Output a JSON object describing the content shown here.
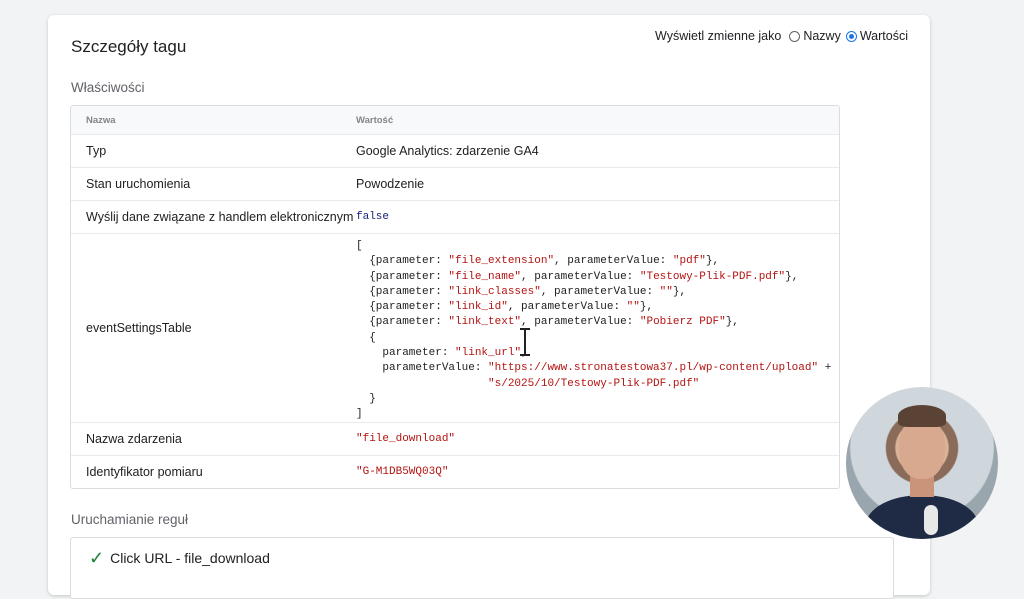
{
  "panel": {
    "title": "Szczegóły tagu",
    "display_toggle": {
      "label": "Wyświetl zmienne jako",
      "options": [
        {
          "label": "Nazwy",
          "selected": false
        },
        {
          "label": "Wartości",
          "selected": true
        }
      ]
    }
  },
  "properties": {
    "section_label": "Właściwości",
    "columns": {
      "name": "Nazwa",
      "value": "Wartość"
    },
    "rows": {
      "type": {
        "name": "Typ",
        "value": "Google Analytics: zdarzenie GA4"
      },
      "status": {
        "name": "Stan uruchomienia",
        "value": "Powodzenie"
      },
      "ecommerce": {
        "name": "Wyślij dane związane z handlem elektronicznym",
        "value": "false"
      },
      "event_settings": {
        "name": "eventSettingsTable",
        "lines": {
          "open": "[",
          "p1_a": "  {parameter: ",
          "p1_b": "\"file_extension\"",
          "p1_c": ", parameterValue: ",
          "p1_d": "\"pdf\"",
          "p1_e": "},",
          "p2_a": "  {parameter: ",
          "p2_b": "\"file_name\"",
          "p2_c": ", parameterValue: ",
          "p2_d": "\"Testowy-Plik-PDF.pdf\"",
          "p2_e": "},",
          "p3_a": "  {parameter: ",
          "p3_b": "\"link_classes\"",
          "p3_c": ", parameterValue: ",
          "p3_d": "\"\"",
          "p3_e": "},",
          "p4_a": "  {parameter: ",
          "p4_b": "\"link_id\"",
          "p4_c": ", parameterValue: ",
          "p4_d": "\"\"",
          "p4_e": "},",
          "p5_a": "  {parameter: ",
          "p5_b": "\"link_text\"",
          "p5_c": ", parameterValue: ",
          "p5_d": "\"Pobierz PDF\"",
          "p5_e": "},",
          "obj_open": "  {",
          "p6_a": "    parameter: ",
          "p6_b": "\"link_url\"",
          "p6_c": ",",
          "p7_a": "    parameterValue: ",
          "p7_b": "\"https://www.stronatestowa37.pl/wp-content/upload\"",
          "p7_c": " +",
          "p8_a": "                    ",
          "p8_b": "\"s/2025/10/Testowy-Plik-PDF.pdf\"",
          "obj_close": "  }",
          "close": "]"
        }
      },
      "event_name": {
        "name": "Nazwa zdarzenia",
        "value": "\"file_download\""
      },
      "measurement_id": {
        "name": "Identyfikator pomiaru",
        "value": "\"G-M1DB5WQ03Q\""
      }
    }
  },
  "firing_rules": {
    "section_label": "Uruchamianie reguł",
    "items": [
      {
        "label": "Click URL - file_download",
        "status": "check-icon"
      }
    ]
  },
  "colors": {
    "accent": "#1a73e8",
    "success": "#188038",
    "string": "#b31412",
    "keyword": "#1a237e"
  }
}
